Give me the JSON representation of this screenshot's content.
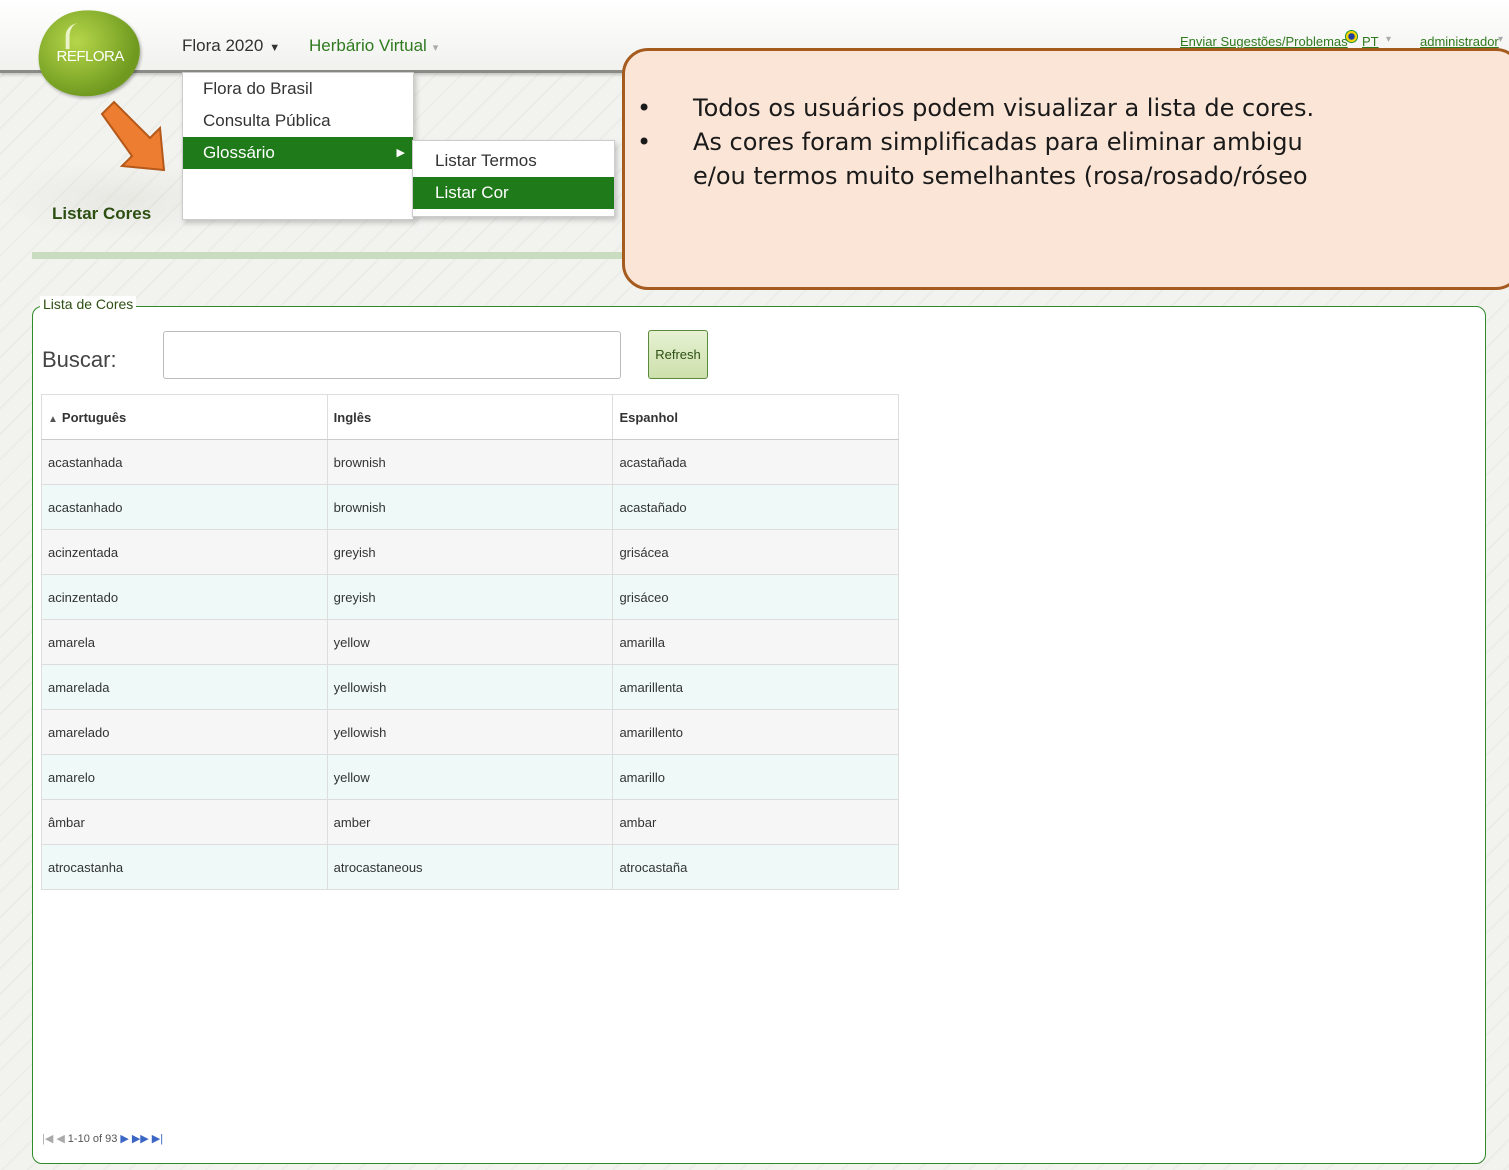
{
  "header": {
    "logo_text": "REFLORA",
    "nav": [
      {
        "label": "Flora 2020"
      },
      {
        "label": "Herbário Virtual"
      }
    ],
    "suggestions_link": "Enviar Sugestões/Problemas",
    "language": "PT",
    "user": "administrador"
  },
  "menu": {
    "items": [
      "Flora do Brasil",
      "Consulta Pública",
      "Glossário"
    ],
    "submenu": [
      "Listar Termos",
      "Listar Cor"
    ]
  },
  "page": {
    "title": "Listar Cores"
  },
  "callout": {
    "lines": [
      "Todos os usuários podem visualizar a lista de cores.",
      "As cores foram simplificadas para eliminar ambigu",
      "e/ou termos muito semelhantes (rosa/rosado/róseo"
    ]
  },
  "panel": {
    "legend": "Lista de Cores",
    "search_label": "Buscar:",
    "search_value": "",
    "refresh_label": "Refresh"
  },
  "table": {
    "columns": [
      "Português",
      "Inglês",
      "Espanhol"
    ],
    "rows": [
      [
        "acastanhada",
        "brownish",
        "acastañada"
      ],
      [
        "acastanhado",
        "brownish",
        "acastañado"
      ],
      [
        "acinzentada",
        "greyish",
        "grisácea"
      ],
      [
        "acinzentado",
        "greyish",
        "grisáceo"
      ],
      [
        "amarela",
        "yellow",
        "amarilla"
      ],
      [
        "amarelada",
        "yellowish",
        "amarillenta"
      ],
      [
        "amarelado",
        "yellowish",
        "amarillento"
      ],
      [
        "amarelo",
        "yellow",
        "amarillo"
      ],
      [
        "âmbar",
        "amber",
        "ambar"
      ],
      [
        "atrocastanha",
        "atrocastaneous",
        "atrocastaña"
      ]
    ]
  },
  "pager": {
    "range": "1-10 of 93"
  }
}
